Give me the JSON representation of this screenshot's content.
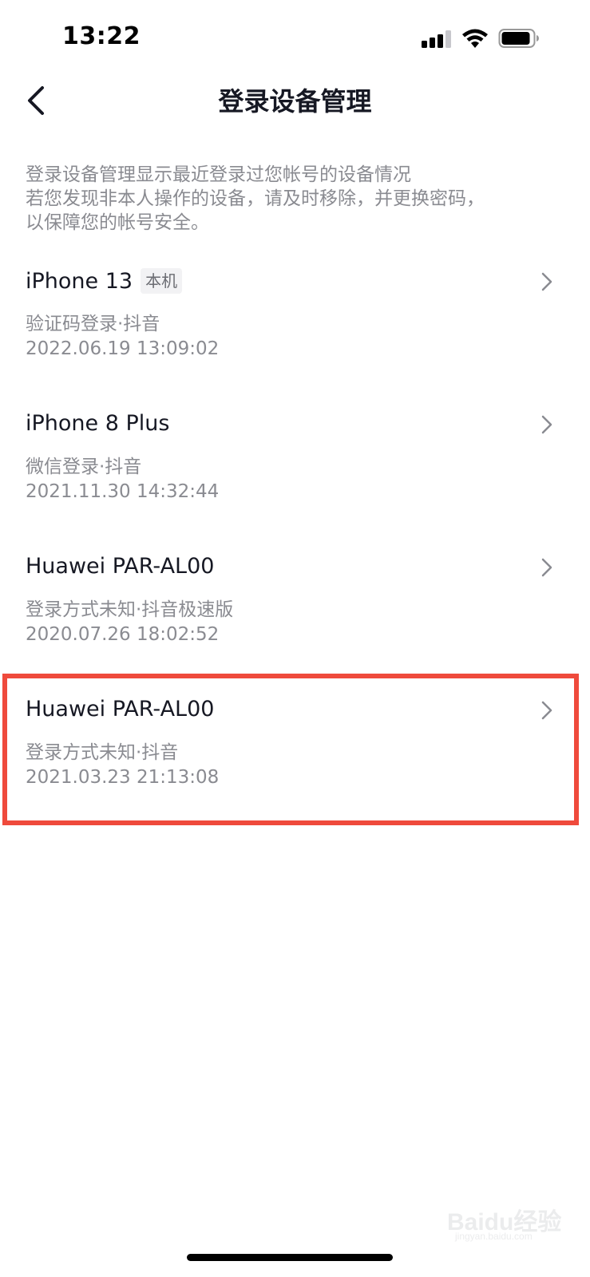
{
  "status_bar": {
    "time": "13:22"
  },
  "nav": {
    "title": "登录设备管理",
    "back_icon": "chevron-left-icon"
  },
  "description": {
    "lines": [
      "登录设备管理显示最近登录过您帐号的设备情况",
      "若您发现非本人操作的设备，请及时移除，并更换密码，",
      "以保障您的帐号安全。"
    ]
  },
  "devices": [
    {
      "name": "iPhone 13",
      "badge": "本机",
      "method": "验证码登录·抖音",
      "time": "2022.06.19 13:09:02"
    },
    {
      "name": "iPhone 8 Plus",
      "method": "微信登录·抖音",
      "time": "2021.11.30 14:32:44"
    },
    {
      "name": "Huawei PAR-AL00",
      "method": "登录方式未知·抖音极速版",
      "time": "2020.07.26 18:02:52"
    },
    {
      "name": "Huawei PAR-AL00",
      "method": "登录方式未知·抖音",
      "time": "2021.03.23 21:13:08"
    }
  ],
  "watermark": {
    "text": "Baidu经验",
    "sub": "jingyan.baidu.com"
  },
  "colors": {
    "highlight": "#ef4a3c",
    "primary_text": "#161823",
    "secondary_text": "#8a8b91"
  }
}
